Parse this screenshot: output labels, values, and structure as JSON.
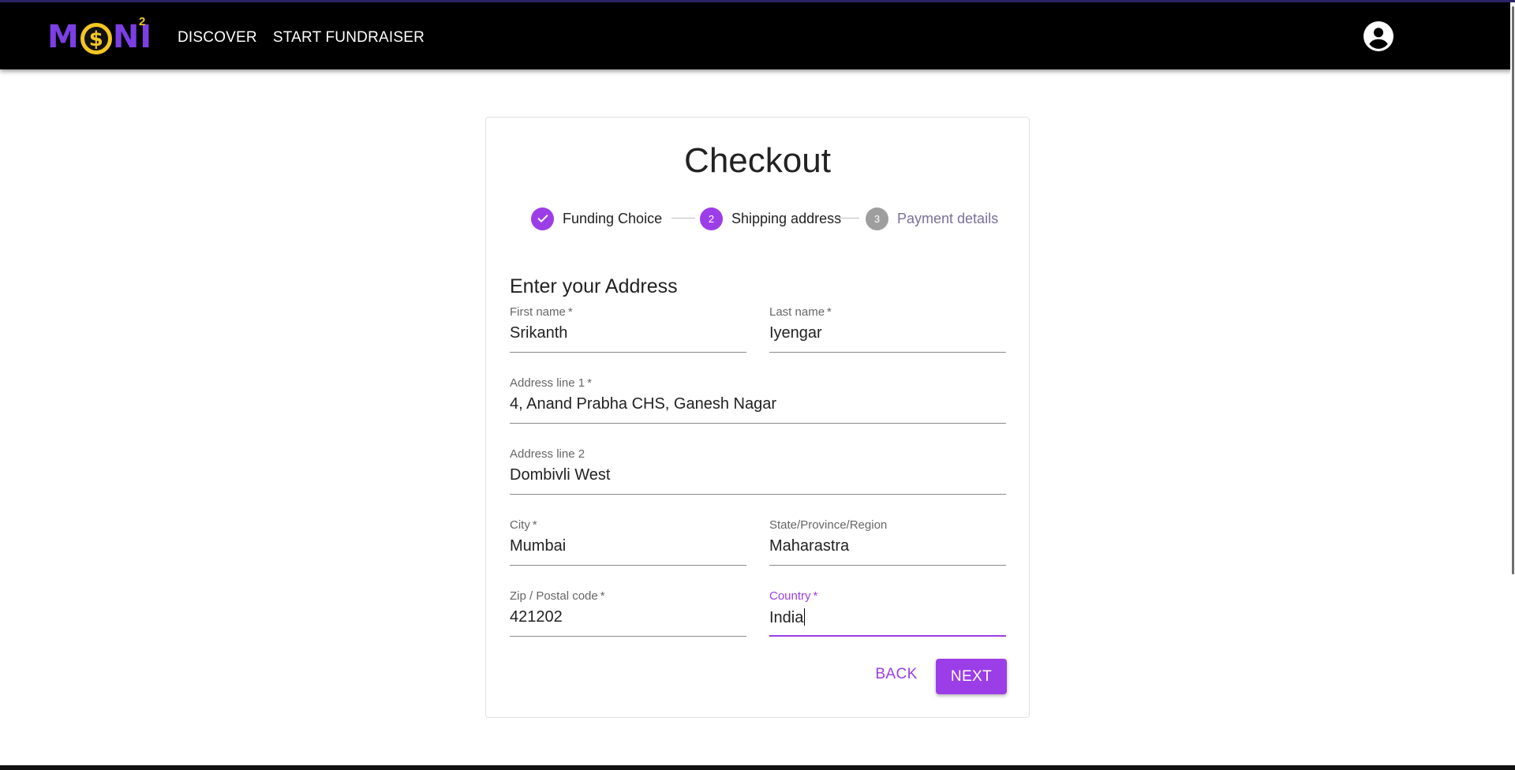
{
  "header": {
    "logo_text_left": "M",
    "logo_coin": "$",
    "logo_text_right": "NI",
    "logo_sup": "2",
    "nav": [
      "DISCOVER",
      "START FUNDRAISER"
    ],
    "account_icon": "account-circle-icon"
  },
  "checkout": {
    "title": "Checkout",
    "steps": [
      {
        "label": "Funding Choice",
        "state": "done",
        "icon": "check-icon"
      },
      {
        "label": "Shipping address",
        "state": "active",
        "number": "2"
      },
      {
        "label": "Payment details",
        "state": "pending",
        "number": "3"
      }
    ],
    "section_title": "Enter your Address",
    "fields": {
      "first_name": {
        "label": "First name",
        "required": "*",
        "value": "Srikanth"
      },
      "last_name": {
        "label": "Last name",
        "required": "*",
        "value": "Iyengar"
      },
      "address1": {
        "label": "Address line 1",
        "required": "*",
        "value": "4, Anand Prabha CHS, Ganesh Nagar"
      },
      "address2": {
        "label": "Address line 2",
        "value": "Dombivli West"
      },
      "city": {
        "label": "City",
        "required": "*",
        "value": "Mumbai"
      },
      "state": {
        "label": "State/Province/Region",
        "value": "Maharastra"
      },
      "zip": {
        "label": "Zip / Postal code",
        "required": "*",
        "value": "421202"
      },
      "country": {
        "label": "Country",
        "required": "*",
        "value": "India"
      }
    },
    "buttons": {
      "back": "BACK",
      "next": "NEXT"
    }
  },
  "colors": {
    "accent": "#9c3ee8",
    "logo_gold": "#f3c623",
    "logo_purple": "#7b3fe4",
    "header_bg": "#000000"
  }
}
